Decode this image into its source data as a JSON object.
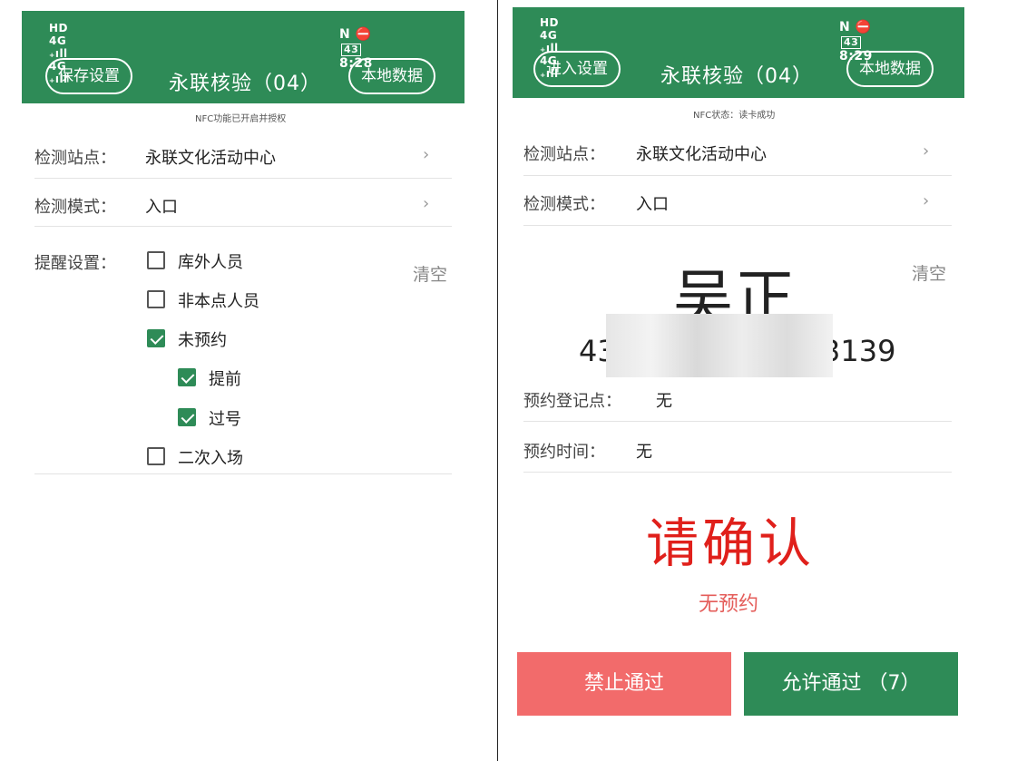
{
  "left": {
    "status": {
      "left": "HD  4G ₊ıll  4G ₊ıll",
      "right_icons": "N ⛔",
      "battery": "43",
      "time": "8:28"
    },
    "header": {
      "left_button": "保存设置",
      "title": "永联核验（04）",
      "right_button": "本地数据"
    },
    "nfc_text": "NFC功能已开启并授权",
    "rows": [
      {
        "label": "检测站点：",
        "value": "永联文化活动中心"
      },
      {
        "label": "检测模式：",
        "value": "入口"
      }
    ],
    "reminder": {
      "label": "提醒设置：",
      "clear": "清空",
      "options": [
        {
          "label": "库外人员",
          "checked": false
        },
        {
          "label": "非本点人员",
          "checked": false
        },
        {
          "label": "未预约",
          "checked": true
        },
        {
          "label": "提前",
          "checked": true
        },
        {
          "label": "过号",
          "checked": true
        },
        {
          "label": "二次入场",
          "checked": false
        }
      ]
    }
  },
  "right": {
    "status": {
      "left": "HD  4G ₊ıll  4G ₊ıll",
      "right_icons": "N ⛔",
      "battery": "43",
      "time": "8:29"
    },
    "header": {
      "left_button": "进入设置",
      "title": "永联核验（04）",
      "right_button": "本地数据"
    },
    "nfc_text": "NFC状态：读卡成功",
    "rows": [
      {
        "label": "检测站点：",
        "value": "永联文化活动中心"
      },
      {
        "label": "检测模式：",
        "value": "入口"
      }
    ],
    "clear": "清空",
    "person": {
      "name": "吴正",
      "id_prefix": "43",
      "id_suffix": "3139"
    },
    "info": [
      {
        "label": "预约登记点：",
        "value": "无"
      },
      {
        "label": "预约时间：",
        "value": "无"
      }
    ],
    "confirm": "请确认",
    "no_appointment": "无预约",
    "buttons": {
      "deny": "禁止通过",
      "allow": "允许通过 （7）"
    }
  },
  "chevron": "›",
  "colors": {
    "primary": "#2e8b57",
    "danger": "#e0201b",
    "deny_button": "#f26b6b"
  }
}
